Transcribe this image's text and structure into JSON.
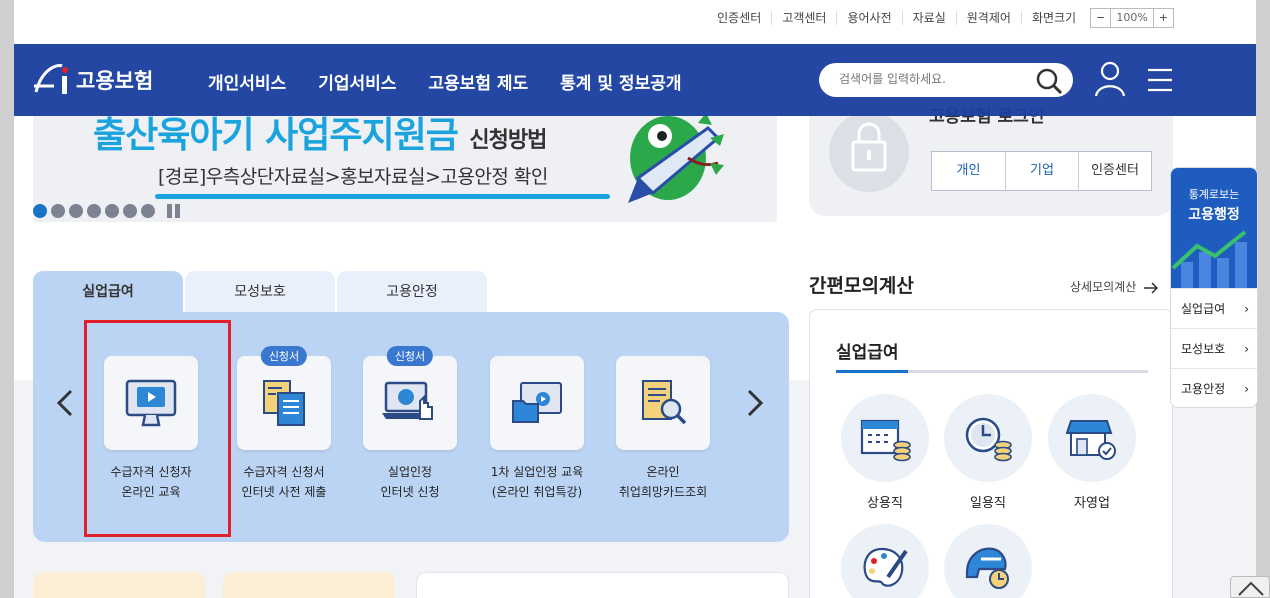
{
  "util": {
    "links": [
      "인증센터",
      "고객센터",
      "용어사전",
      "자료실",
      "원격제어"
    ],
    "zoom_label": "화면크기",
    "zoom_minus": "−",
    "zoom_value": "100%",
    "zoom_plus": "+"
  },
  "header": {
    "logo_text": "고용보험",
    "gnb": [
      "개인서비스",
      "기업서비스",
      "고용보험 제도",
      "통계 및 정보공개"
    ],
    "search_placeholder": "검색어를 입력하세요."
  },
  "banner": {
    "title": "출산육아기 사업주지원금",
    "title_suffix": "신청방법",
    "route": "[경로]우측상단자료실>홍보자료실>고용안정 확인"
  },
  "login": {
    "title": "고용보험 로그인",
    "buttons": [
      "개인",
      "기업",
      "인증센터"
    ]
  },
  "tabs": [
    "실업급여",
    "모성보호",
    "고용안정"
  ],
  "services": [
    {
      "line1": "수급자격 신청자",
      "line2": "온라인 교육",
      "badge": ""
    },
    {
      "line1": "수급자격 신청서",
      "line2": "인터넷 사전 제출",
      "badge": "신청서"
    },
    {
      "line1": "실업인정",
      "line2": "인터넷 신청",
      "badge": "신청서"
    },
    {
      "line1": "1차 실업인정 교육",
      "line2": "(온라인 취업특강)",
      "badge": ""
    },
    {
      "line1": "온라인",
      "line2": "취업희망카드조회",
      "badge": ""
    }
  ],
  "calc": {
    "title": "간편모의계산",
    "more": "상세모의계산",
    "subtitle": "실업급여",
    "items": [
      "상용직",
      "일용직",
      "자영업"
    ]
  },
  "quick": {
    "top_line1": "통계로보는",
    "top_line2": "고용행정",
    "items": [
      "실업급여",
      "모성보호",
      "고용안정"
    ]
  },
  "colors": {
    "header_blue": "#1b3fa0",
    "accent_blue": "#1a73c8",
    "banner_cyan": "#1aa3dd",
    "highlight_red": "#e0202a"
  }
}
